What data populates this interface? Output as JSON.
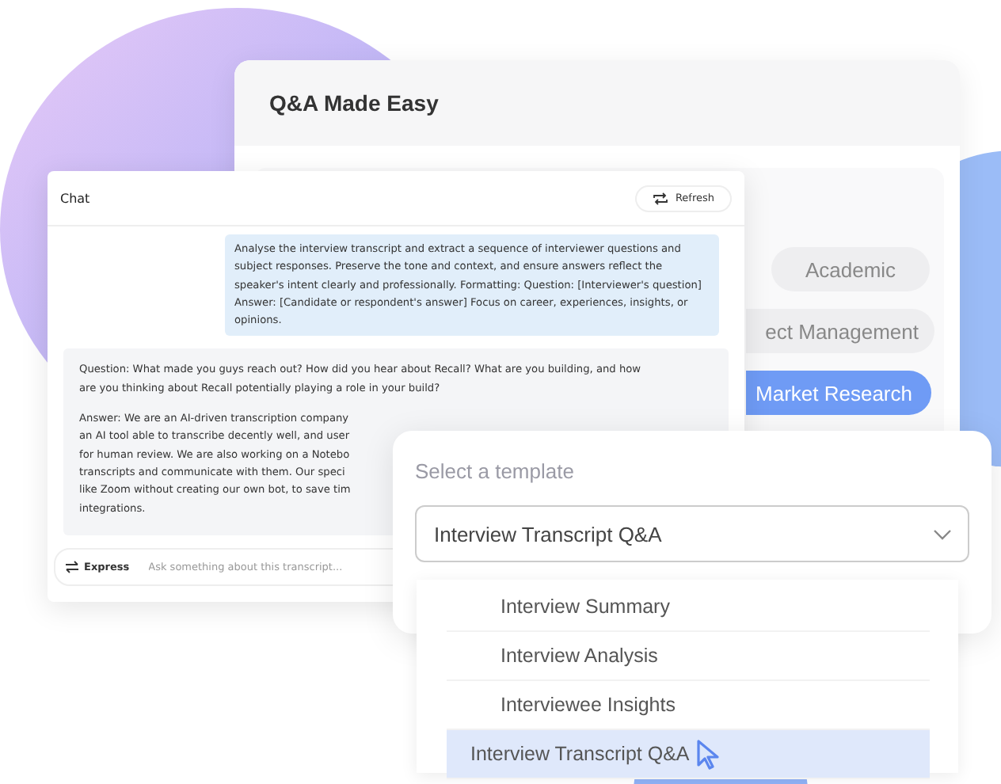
{
  "panel": {
    "title": "Q&A Made Easy"
  },
  "categories": [
    {
      "label": "Academic",
      "selected": false
    },
    {
      "label": "ect Management",
      "selected": false
    },
    {
      "label": "Market Research",
      "selected": true
    }
  ],
  "chat": {
    "title": "Chat",
    "refresh_button": "Refresh",
    "prompt": "Analyse the interview transcript and extract a sequence of interviewer questions and subject responses. Preserve the tone and context, and ensure answers reflect the speaker's intent clearly and professionally. Formatting: Question: [Interviewer's question] Answer: [Candidate or respondent's answer] Focus on career, experiences, insights, or opinions.",
    "question": "Question: What made you guys reach out? How did you hear about Recall? What are you building, and how are you thinking about Recall potentially playing a role in your build?",
    "answer_lines": [
      "Answer: We are an AI-driven transcription company",
      "an AI tool able to transcribe decently well, and user",
      "for human review. We are also working on a Notebo",
      "transcripts and communicate with them. Our speci",
      "like Zoom without creating our own bot, to save tim",
      "integrations."
    ],
    "mode_button": "Express",
    "input_placeholder": "Ask something about this transcript..."
  },
  "template": {
    "label": "Select a template",
    "value": "Interview Transcript Q&A",
    "options": [
      {
        "label": "Interview Summary",
        "selected": false
      },
      {
        "label": "Interview Analysis",
        "selected": false
      },
      {
        "label": "Interviewee Insights",
        "selected": false
      },
      {
        "label": "Interview Transcript Q&A",
        "selected": true
      }
    ]
  }
}
